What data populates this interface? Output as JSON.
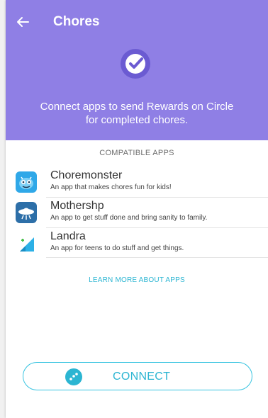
{
  "header": {
    "title": "Chores",
    "subtitle": "Connect apps to send Rewards on Circle for completed chores.",
    "back_icon": "arrow-left-icon",
    "badge_icon": "check-circle-icon",
    "background": "#8f7fe5"
  },
  "compatible": {
    "title": "COMPATIBLE APPS",
    "apps": [
      {
        "name": "Choremonster",
        "description": "An app that makes chores fun for kids!",
        "icon": "choremonster-logo-icon"
      },
      {
        "name": "Mothershp",
        "description": "An app to get stuff done and bring sanity to family.",
        "icon": "mothershp-logo-icon"
      },
      {
        "name": "Landra",
        "description": "An app for teens to do stuff and get things.",
        "icon": "landra-logo-icon"
      }
    ]
  },
  "learn_more": "LEARN MORE ABOUT APPS",
  "connect": {
    "label": "CONNECT",
    "icon": "dots-icon",
    "accent": "#2bb5d2"
  }
}
